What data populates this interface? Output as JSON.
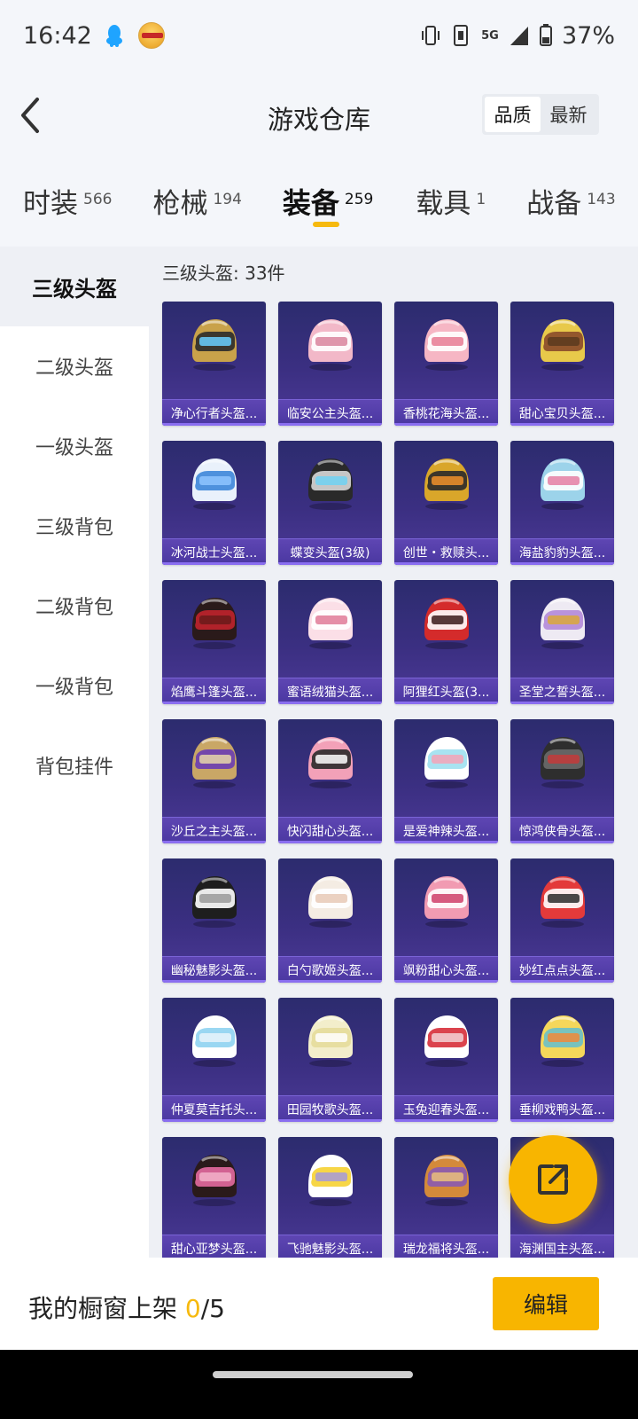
{
  "status_bar": {
    "time": "16:42",
    "network": "5G",
    "battery": "37%",
    "icons": [
      "qq-icon",
      "app-icon",
      "vibrate-icon",
      "sim-icon",
      "5g-icon",
      "signal-icon",
      "battery-icon"
    ]
  },
  "header": {
    "title": "游戏仓库",
    "sort_options": [
      "品质",
      "最新"
    ],
    "sort_selected": "品质"
  },
  "tabs": [
    {
      "label": "时装",
      "count": "566"
    },
    {
      "label": "枪械",
      "count": "194"
    },
    {
      "label": "装备",
      "count": "259"
    },
    {
      "label": "载具",
      "count": "1"
    },
    {
      "label": "战备",
      "count": "143"
    }
  ],
  "active_tab": "装备",
  "sidebar": {
    "items": [
      "三级头盔",
      "二级头盔",
      "一级头盔",
      "三级背包",
      "二级背包",
      "一级背包",
      "背包挂件"
    ],
    "active": "三级头盔"
  },
  "section": {
    "title": "三级头盔: 33件"
  },
  "items": [
    {
      "name": "净心行者头盔...",
      "colors": [
        "#c9a24a",
        "#2b2b2b",
        "#6ad0ff"
      ]
    },
    {
      "name": "临安公主头盔...",
      "colors": [
        "#f2b8c8",
        "#ffffff",
        "#d9849c"
      ]
    },
    {
      "name": "香桃花海头盔...",
      "colors": [
        "#f6b6c4",
        "#ffffff",
        "#e77a93"
      ]
    },
    {
      "name": "甜心宝贝头盔...",
      "colors": [
        "#e8c94a",
        "#8a4a2a",
        "#5a3a1e"
      ]
    },
    {
      "name": "冰河战士头盔...",
      "colors": [
        "#e9f1fb",
        "#3d86d9",
        "#8fc4ff"
      ]
    },
    {
      "name": "蝶变头盔(3级)",
      "colors": [
        "#2a2a2a",
        "#d7d7d7",
        "#6fd1f2"
      ]
    },
    {
      "name": "创世・救赎头...",
      "colors": [
        "#d9a62a",
        "#2a2a2a",
        "#f0902a"
      ]
    },
    {
      "name": "海盐豹豹头盔...",
      "colors": [
        "#9cd3ea",
        "#ffffff",
        "#e47ea3"
      ]
    },
    {
      "name": "焰鹰斗篷头盔...",
      "colors": [
        "#2a1a1a",
        "#c0232c",
        "#6a1a1a"
      ]
    },
    {
      "name": "蜜语绒猫头盔...",
      "colors": [
        "#fbdfe7",
        "#ffffff",
        "#e07a98"
      ]
    },
    {
      "name": "阿狸红头盔(3...",
      "colors": [
        "#d42b2b",
        "#ffffff",
        "#3a1a1a"
      ]
    },
    {
      "name": "圣堂之誓头盔...",
      "colors": [
        "#eeeaf3",
        "#b38ad9",
        "#d9a83a"
      ]
    },
    {
      "name": "沙丘之主头盔...",
      "colors": [
        "#c9a766",
        "#6a3db3",
        "#e8d7a8"
      ]
    },
    {
      "name": "快闪甜心头盔...",
      "colors": [
        "#f2a1b8",
        "#2a2a2a",
        "#ffffff"
      ]
    },
    {
      "name": "是爱神辣头盔...",
      "colors": [
        "#ffffff",
        "#9ee0f0",
        "#f5a3b7"
      ]
    },
    {
      "name": "惊鸿侠骨头盔...",
      "colors": [
        "#2e2e2e",
        "#6a6a6a",
        "#c43a3a"
      ]
    },
    {
      "name": "幽秘魅影头盔...",
      "colors": [
        "#1e1e1e",
        "#ffffff",
        "#9a9a9a"
      ]
    },
    {
      "name": "白勺歌姬头盔...",
      "colors": [
        "#f4ece3",
        "#ffffff",
        "#e7c9b6"
      ]
    },
    {
      "name": "飒粉甜心头盔...",
      "colors": [
        "#f19bb2",
        "#ffffff",
        "#cf3e6a"
      ]
    },
    {
      "name": "妙红点点头盔...",
      "colors": [
        "#e33a3a",
        "#ffffff",
        "#2a2a2a"
      ]
    },
    {
      "name": "仲夏莫吉托头...",
      "colors": [
        "#ffffff",
        "#8fd3f1",
        "#e9f5fb"
      ]
    },
    {
      "name": "田园牧歌头盔...",
      "colors": [
        "#f3eecb",
        "#e6dc9b",
        "#ffffff"
      ]
    },
    {
      "name": "玉兔迎春头盔...",
      "colors": [
        "#ffffff",
        "#d72f3a",
        "#f3d2d6"
      ]
    },
    {
      "name": "垂柳戏鸭头盔...",
      "colors": [
        "#f5d75a",
        "#6ac0c8",
        "#f08a3a"
      ]
    },
    {
      "name": "甜心亚梦头盔...",
      "colors": [
        "#2a1a1a",
        "#e46aa0",
        "#f3b2c9"
      ]
    },
    {
      "name": "飞驰魅影头盔...",
      "colors": [
        "#ffffff",
        "#f6d232",
        "#a69ad9"
      ]
    },
    {
      "name": "瑞龙福将头盔...",
      "colors": [
        "#d48a3a",
        "#8a5ab3",
        "#e9c07a"
      ]
    },
    {
      "name": "海渊国主头盔...",
      "colors": [
        "#2a5fb3",
        "#6ac8e0",
        "#ffffff"
      ]
    }
  ],
  "bottom_bar": {
    "shelf_label": "我的橱窗上架 ",
    "shelf_current": "0",
    "shelf_total": "/5",
    "edit_label": "编辑"
  },
  "accent_color": "#f8b500"
}
